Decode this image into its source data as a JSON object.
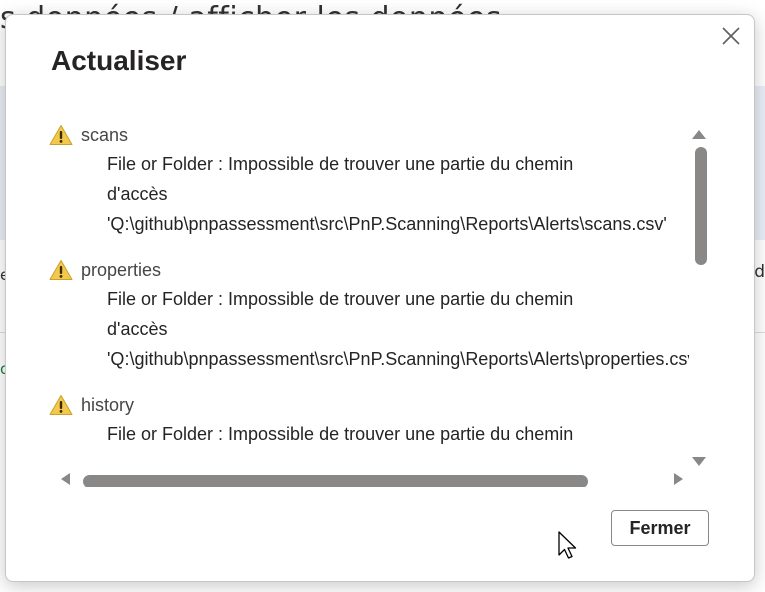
{
  "background": {
    "title_fragment": "s          données / afficher les données",
    "right_fragment": "d",
    "left_fragment_1": "e",
    "left_fragment_2": "",
    "green_fragment": "o"
  },
  "dialog": {
    "title": "Actualiser",
    "close_icon": "close-icon",
    "entries": [
      {
        "name": "scans",
        "icon": "warning-icon",
        "message_lines": [
          "File or Folder : Impossible de trouver une partie du chemin",
          "d'accès",
          "'Q:\\github\\pnpassessment\\src\\PnP.Scanning\\Reports\\Alerts\\scans.csv'"
        ]
      },
      {
        "name": "properties",
        "icon": "warning-icon",
        "message_lines": [
          "File or Folder : Impossible de trouver une partie du chemin",
          "d'accès",
          "'Q:\\github\\pnpassessment\\src\\PnP.Scanning\\Reports\\Alerts\\properties.csv'"
        ]
      },
      {
        "name": "history",
        "icon": "warning-icon",
        "message_lines": [
          "File or Folder : Impossible de trouver une partie du chemin"
        ]
      }
    ],
    "close_button_label": "Fermer"
  },
  "colors": {
    "warning_fill": "#F2C94C",
    "warning_mark": "#3b2a00",
    "scroll_thumb": "#8a8886"
  }
}
